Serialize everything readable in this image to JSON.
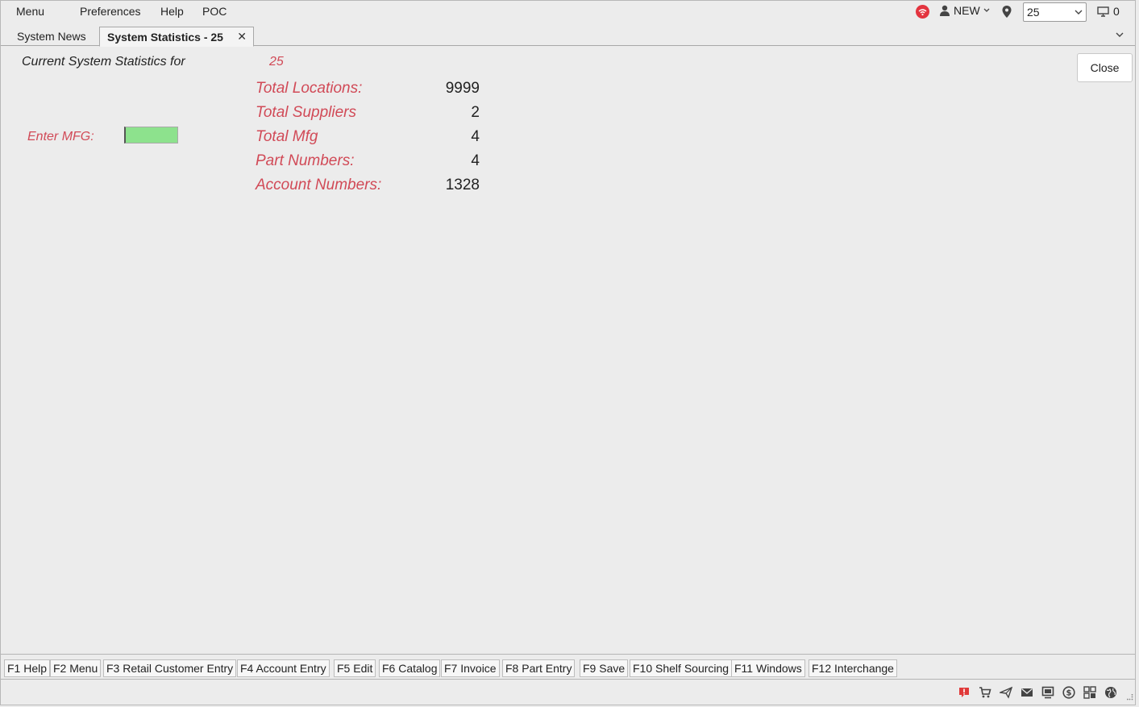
{
  "menubar": {
    "items": [
      "Menu",
      "Preferences",
      "Help",
      "POC"
    ],
    "user_label": "NEW",
    "location_value": "25",
    "monitor_count": "0"
  },
  "tabs": [
    {
      "label": "System News",
      "active": false
    },
    {
      "label": "System Statistics - 25",
      "active": true
    }
  ],
  "main": {
    "heading": "Current System Statistics for",
    "unit": "25",
    "mfg_label": "Enter MFG:",
    "mfg_value": "",
    "stats": [
      {
        "label": "Total Locations:",
        "value": "9999"
      },
      {
        "label": "Total Suppliers",
        "value": "2"
      },
      {
        "label": "Total Mfg",
        "value": "4"
      },
      {
        "label": "Part Numbers:",
        "value": "4"
      },
      {
        "label": "Account Numbers:",
        "value": "1328"
      }
    ],
    "close_label": "Close"
  },
  "fkeys": [
    "F1 Help",
    "F2 Menu",
    "F3 Retail Customer Entry",
    "F4 Account Entry",
    "F5 Edit",
    "F6 Catalog",
    "F7 Invoice",
    "F8 Part Entry",
    "F9 Save",
    "F10 Shelf Sourcing",
    "F11 Windows",
    "F12 Interchange"
  ],
  "statusbar": {
    "icons": [
      "alert-icon",
      "cart-icon",
      "send-icon",
      "mail-icon",
      "terminal-icon",
      "dollar-icon",
      "grid-icon",
      "globe-icon"
    ]
  },
  "colors": {
    "accent_red": "#d14a57",
    "mfg_input_bg": "#8de28d",
    "wifi_badge": "#e3343f"
  }
}
